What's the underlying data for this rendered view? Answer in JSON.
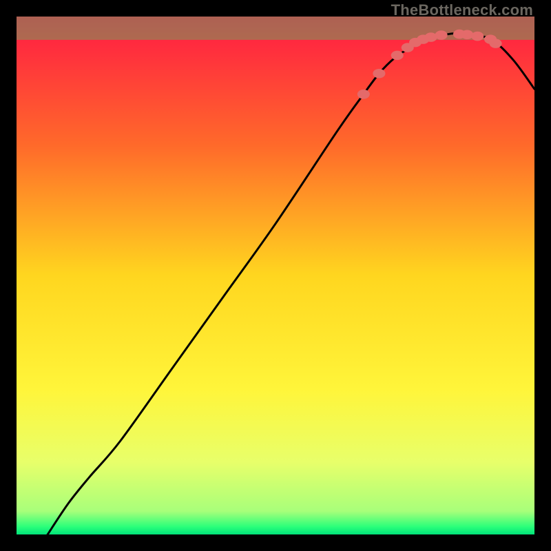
{
  "watermark": "TheBottleneck.com",
  "chart_data": {
    "type": "line",
    "title": "",
    "xlabel": "",
    "ylabel": "",
    "xlim": [
      0,
      100
    ],
    "ylim": [
      0,
      100
    ],
    "grid": false,
    "legend": false,
    "gradient_stops": [
      {
        "offset": 0,
        "color": "#ff1a44"
      },
      {
        "offset": 0.25,
        "color": "#ff6a2a"
      },
      {
        "offset": 0.5,
        "color": "#ffd61f"
      },
      {
        "offset": 0.72,
        "color": "#fff53a"
      },
      {
        "offset": 0.86,
        "color": "#e8ff6a"
      },
      {
        "offset": 0.955,
        "color": "#a8ff7a"
      },
      {
        "offset": 0.985,
        "color": "#2bff7a"
      },
      {
        "offset": 1.0,
        "color": "#00e37a"
      }
    ],
    "green_band": {
      "y_from": 95.5,
      "y_to": 100
    },
    "series": [
      {
        "name": "bottleneck-curve",
        "color": "#000000",
        "x": [
          6,
          10,
          14,
          20,
          30,
          40,
          50,
          62,
          67,
          70,
          73,
          76,
          79,
          82,
          84,
          86,
          89,
          92,
          96,
          100
        ],
        "y": [
          0,
          6,
          11,
          18,
          32,
          46,
          60,
          78,
          85,
          89,
          92,
          94,
          95.5,
          96.3,
          96.7,
          96.7,
          96.3,
          95.4,
          91.5,
          86
        ]
      }
    ],
    "markers": {
      "name": "highlight-points",
      "color": "#e46a6a",
      "rx": 1.2,
      "ry": 0.9,
      "points": [
        {
          "x": 67,
          "y": 85
        },
        {
          "x": 70,
          "y": 89
        },
        {
          "x": 73.5,
          "y": 92.5
        },
        {
          "x": 75.5,
          "y": 94
        },
        {
          "x": 77,
          "y": 95
        },
        {
          "x": 78.5,
          "y": 95.6
        },
        {
          "x": 80,
          "y": 96
        },
        {
          "x": 82,
          "y": 96.4
        },
        {
          "x": 85.5,
          "y": 96.6
        },
        {
          "x": 87,
          "y": 96.5
        },
        {
          "x": 89,
          "y": 96.2
        },
        {
          "x": 91.5,
          "y": 95.6
        },
        {
          "x": 92.5,
          "y": 94.8
        }
      ]
    }
  }
}
